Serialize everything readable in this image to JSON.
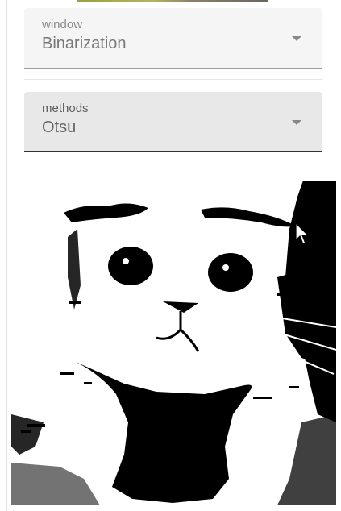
{
  "window_field": {
    "label": "window",
    "value": "Binarization"
  },
  "methods_field": {
    "label": "methods",
    "value": "Otsu"
  },
  "icons": {
    "dropdown": "chevron-down-icon",
    "cursor": "mouse-pointer-icon"
  },
  "colors": {
    "field_bg": "#f5f5f5",
    "field_bg_active": "#e8e8e8",
    "underline_active": "#333333",
    "image_fg": "#000000",
    "image_bg": "#ffffff"
  }
}
